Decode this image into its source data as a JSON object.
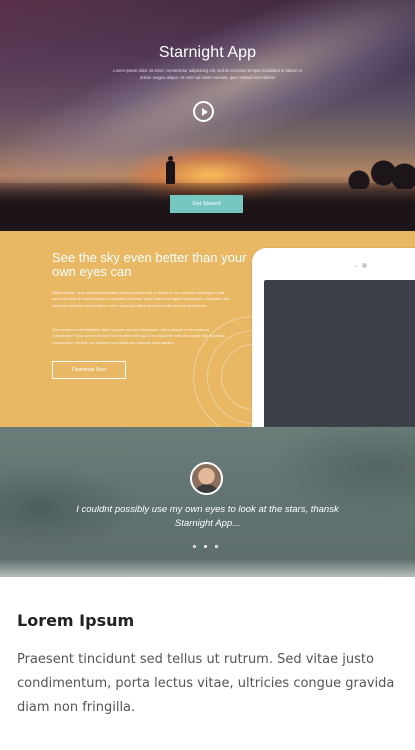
{
  "hero": {
    "title": "Starnight App",
    "subtitle": "Lorem ipsum dolor sit amet, consectetur adipisicing elit, sed do eiusmod tempor incididunt ut labore et dolore magna aliqua. Ut enim ad minim veniam, quis nostrud exercitation",
    "cta_label": "Get Started"
  },
  "feature": {
    "heading": "See the sky even better than your own eyes can",
    "paragraph_1": "Minim veniam, quis nostrud exercitation ullamco laboris nisi ut aliquip ex ea commodo consequat. Duis aute irure dolor in reprehenderit in voluptate velit esse cillum dolore eu fugiat nulla pariatur. Excepteur sint occaecat cupidatat non proident, sunt in culpa qui officia deserunt mollit anim id est laborum.",
    "paragraph_2": "Quis nostrum exercitationem ullam corporis suscipit laboriosam, nisi ut aliquid ex ea commodi consequatur? Quis autem vel eum iure reprehenderit qui in ea voluptate velit esse quam nihil molestiae consequatur, vel illum qui dolorem eum fugiat quo voluptas nulla pariatur.",
    "download_label": "Download Now"
  },
  "testimonial": {
    "quote": "I couldnt possibly use my own eyes to look at the stars, thansk Starnight App...",
    "active_slide": 2,
    "slide_count": 3
  },
  "text_section": {
    "heading": "Lorem Ipsum",
    "body": "Praesent tincidunt sed tellus ut rutrum. Sed vitae justo condimentum, porta lectus vitae, ultricies congue gravida diam non fringilla."
  },
  "colors": {
    "accent_teal": "#76c7c0",
    "feature_yellow": "#e8b865",
    "testimonial_slate": "#607270"
  }
}
